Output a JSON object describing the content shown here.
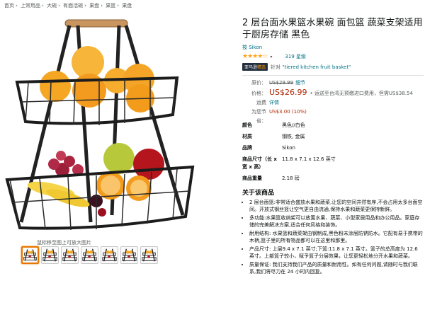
{
  "breadcrumb": [
    "首页",
    "上常用品",
    "大碗",
    "有面活碗",
    "果盘",
    "果篮",
    "果盘"
  ],
  "gallery": {
    "hover_hint": "鼠标移至图上可放大图片",
    "thumbnail_count": 7
  },
  "product": {
    "title": "2 层台面水果篮水果碗 面包篮 蔬菜支架适用于厨房存储 黑色",
    "brand": "按 Sikon",
    "stars_display": "★★★★☆",
    "rating_count": "319 星级",
    "choice_badge_prefix": "亚马逊",
    "choice_badge_suffix": "精选",
    "choice_for": "针对",
    "choice_keyword": "\"tiered kitchen fruit basket\"",
    "price_rows": {
      "list_label": "原价：",
      "list_price": "US$29.99",
      "list_detail": "细节",
      "price_label": "价格：",
      "price": "US$26.99",
      "price_note": "• 运送至台湾无预缴进口费用，但需US$38.54",
      "shipping_label": "运费",
      "shipping_link": "详情",
      "savings_label": "为您节省：",
      "savings": "US$3.00 (10%)"
    },
    "specs": [
      {
        "key": "颜色",
        "value": "黑色//白色"
      },
      {
        "key": "材质",
        "value": "钢铁, 金属"
      },
      {
        "key": "品牌",
        "value": "Sikon"
      },
      {
        "key": "商品尺寸（长 x 宽 x 高）",
        "value": "11.8 x 7.1 x 12.6 英寸"
      },
      {
        "key": "商品重量",
        "value": "2.18 磅"
      }
    ],
    "about_title": "关于该商品",
    "about_items": [
      "2 层台面篮:非常适合盛放水果和蔬菜,让您的空间井然有序,不会占用太多台面空间。开放式钢丝篮让空气更自由流通,保持水果和蔬菜更保持新鲜。",
      "多功能:水果篮收纳架可以放置水果、蔬菜、小型家居用品和办公用品。家庭存储的完美解决方案,适合任何风格和装饰。",
      "耐用结构: 水果篮和蔬菜架由钢制成,黑色粉末涂层防锈防水。它配有易于携带的木柄,篮子里的所有物品都可以在这里和那里。",
      "产品尺寸: 上层9.4 x 7.1 英寸;下篮:11.8 x 7.1 英寸。篮子的总高度为 12.6 英寸。上部篮子较小，赋予篮子分层效果，让您更轻松地分开水果和蔬菜。",
      "质量保证: 我们支持我们产品的质量和耐用性。如有任何问题,请随时与我们联系,我们将尽力在 24 小时内回复。"
    ]
  }
}
